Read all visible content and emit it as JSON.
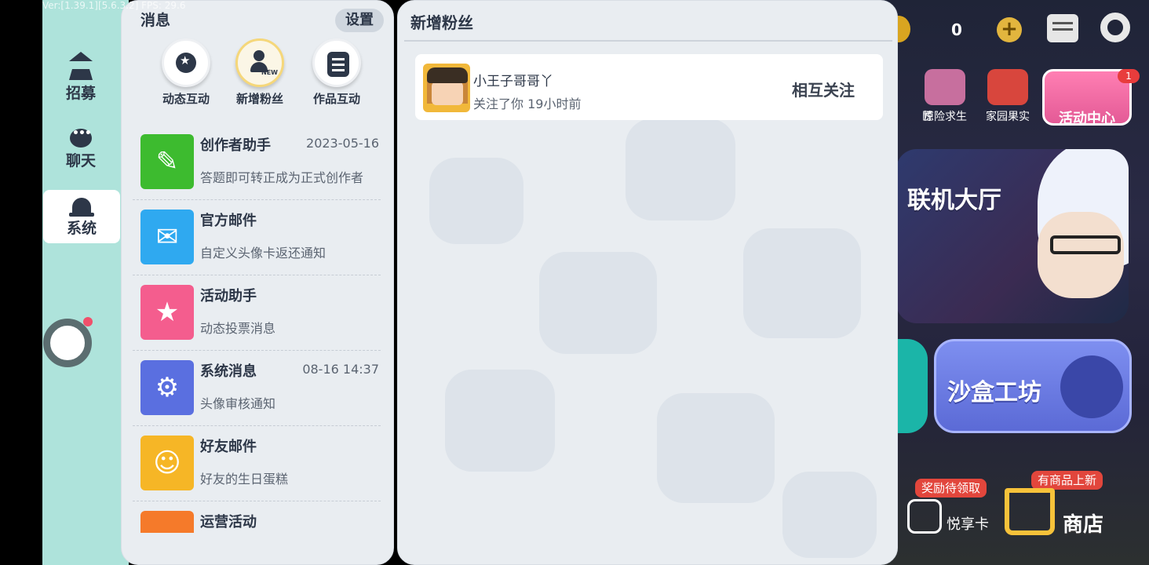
{
  "debug": {
    "version_text": "Ver:[1.39.1][5.6.3.2] FPS: 29.6"
  },
  "sidebar": {
    "items": [
      {
        "label": "招募",
        "icon": "home-icon"
      },
      {
        "label": "聊天",
        "icon": "chat-icon"
      },
      {
        "label": "系统",
        "icon": "bell-icon",
        "active": true
      }
    ]
  },
  "messages": {
    "title": "消息",
    "settings_label": "设置",
    "tabs": [
      {
        "label": "动态互动",
        "icon": "star-icon"
      },
      {
        "label": "新增粉丝",
        "icon": "new-follower-icon",
        "badge": "NEW",
        "active": true
      },
      {
        "label": "作品互动",
        "icon": "list-icon"
      }
    ],
    "items": [
      {
        "title": "创作者助手",
        "date": "2023-05-16",
        "subtitle": "答题即可转正成为正式创作者",
        "icon": "pencil-ruler-icon",
        "color": "#3dbb2f"
      },
      {
        "title": "官方邮件",
        "date": "",
        "subtitle": "自定义头像卡返还通知",
        "icon": "envelope-icon",
        "color": "#2fa9f0"
      },
      {
        "title": "活动助手",
        "date": "",
        "subtitle": "动态投票消息",
        "icon": "bookmark-star-icon",
        "color": "#f45d8e"
      },
      {
        "title": "系统消息",
        "date": "08-16 14:37",
        "subtitle": "头像审核通知",
        "icon": "gear-icon",
        "color": "#5a6fe0"
      },
      {
        "title": "好友邮件",
        "date": "",
        "subtitle": "好友的生日蛋糕",
        "icon": "friend-mail-icon",
        "color": "#f6b626"
      },
      {
        "title": "运营活动",
        "date": "",
        "subtitle": "",
        "icon": "megaphone-icon",
        "color": "#f57a2a"
      }
    ]
  },
  "followers": {
    "title": "新增粉丝",
    "entries": [
      {
        "name": "小王子哥哥丫",
        "detail": "关注了你  19小时前",
        "action": "相互关注"
      }
    ]
  },
  "game": {
    "coin_count": "0",
    "features": [
      {
        "label": "惊险求生"
      },
      {
        "label": "家园果实"
      }
    ],
    "partial_label": "匠",
    "activity_center": {
      "label": "活动中心",
      "badge": "1"
    },
    "hall_label": "联机大厅",
    "sandbox_label": "沙盒工坊",
    "reward_badge": "奖励待领取",
    "new_goods_badge": "有商品上新",
    "pass_label": "悦享卡",
    "shop_label": "商店"
  }
}
